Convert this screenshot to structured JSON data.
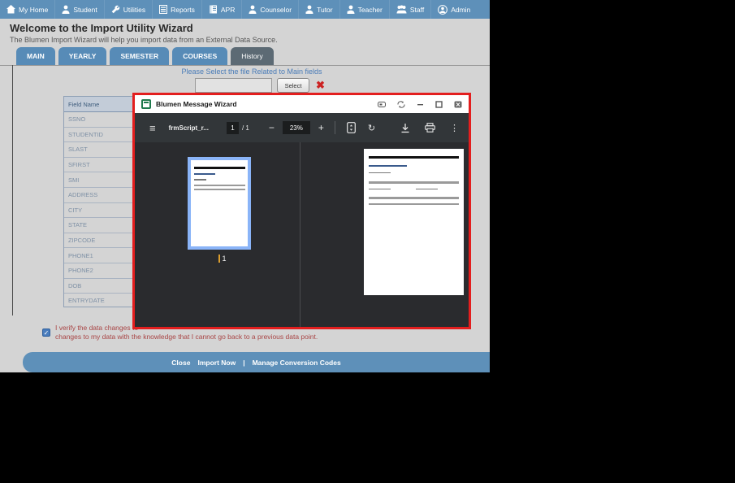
{
  "nav": {
    "items": [
      {
        "label": "My Home"
      },
      {
        "label": "Student"
      },
      {
        "label": "Utilities"
      },
      {
        "label": "Reports"
      },
      {
        "label": "APR"
      },
      {
        "label": "Counselor"
      },
      {
        "label": "Tutor"
      },
      {
        "label": "Teacher"
      },
      {
        "label": "Staff"
      },
      {
        "label": "Admin"
      }
    ]
  },
  "header": {
    "title": "Welcome to the Import Utility Wizard",
    "subtitle": "The Blumen Import Wizard will help you import data from an External Data Source."
  },
  "tabs": {
    "main": "MAIN",
    "yearly": "YEARLY",
    "semester": "SEMESTER",
    "courses": "COURSES",
    "history": "History"
  },
  "file_select": {
    "prompt": "Please Select the file Related to Main fields",
    "input_value": "",
    "select_label": "Select",
    "clear_glyph": "✖"
  },
  "field_table": {
    "header": "Field Name",
    "rows": [
      "SSNO",
      "STUDENTID",
      "SLAST",
      "SFIRST",
      "SMI",
      "ADDRESS",
      "CITY",
      "STATE",
      "ZIPCODE",
      "PHONE1",
      "PHONE2",
      "DOB",
      "ENTRYDATE"
    ]
  },
  "modal": {
    "title": "Blumen Message Wizard"
  },
  "pdf_viewer": {
    "doc_title": "frmScript_r...",
    "page_current": "1",
    "page_total": "/ 1",
    "zoom_out_glyph": "−",
    "zoom_level": "23%",
    "zoom_in_glyph": "+",
    "rotate_glyph": "↻",
    "menu_glyph": "≡",
    "kebab_glyph": "⋮",
    "thumb_page_label": "1"
  },
  "verify": {
    "line1": "I verify the data changes to",
    "line2": "changes to my data with the knowledge that I cannot go back to a previous data point.",
    "check_glyph": "✓"
  },
  "footer": {
    "close_label": "Close",
    "import_label": "Import Now",
    "separator": "|",
    "manage_label": "Manage Conversion Codes"
  },
  "colors": {
    "nav_blue": "#5e90b9",
    "tab_blue": "#578bb7",
    "tab_active_gray": "#5c6a74",
    "modal_border_red": "#e31e1e",
    "thumb_select_blue": "#8ab4f8",
    "footer_blue": "#5e90b9",
    "verify_text_red": "#a94646"
  }
}
